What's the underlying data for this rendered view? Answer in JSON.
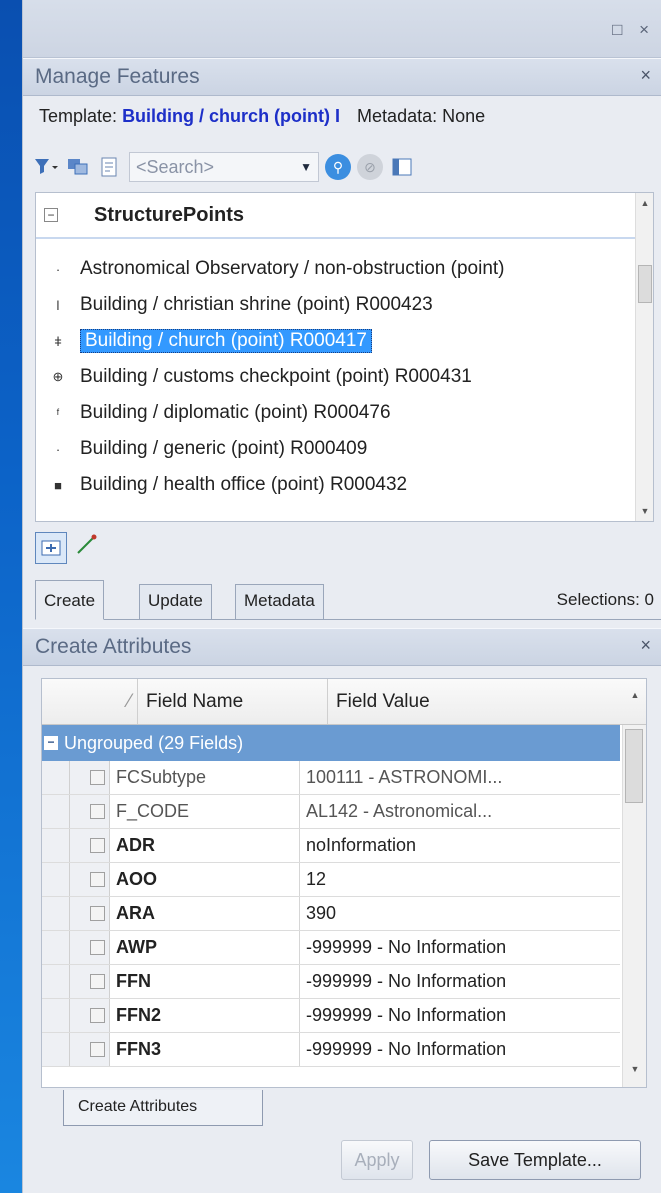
{
  "window": {
    "controls": "□ ×"
  },
  "manage_features": {
    "title": "Manage Features",
    "close": "×",
    "template_label": "Template:",
    "template_name": "Building / church (point) I",
    "metadata_label": "Metadata:",
    "metadata_value": "None",
    "search_placeholder": "<Search>",
    "layer_name": "StructurePoints",
    "items": [
      {
        "symbol": "·",
        "label": "Astronomical Observatory / non-obstruction (point)"
      },
      {
        "symbol": "ǀ",
        "label": "Building / christian shrine (point) R000423"
      },
      {
        "symbol": "ǂ",
        "label": "Building / church (point) R000417"
      },
      {
        "symbol": "⊕",
        "label": "Building / customs checkpoint (point) R000431"
      },
      {
        "symbol": "ᶠ",
        "label": "Building / diplomatic (point) R000476"
      },
      {
        "symbol": "·",
        "label": "Building / generic (point) R000409"
      },
      {
        "symbol": "■",
        "label": "Building / health office (point) R000432"
      }
    ],
    "selected_index": 2
  },
  "tabs": {
    "create": "Create",
    "update": "Update",
    "metadata": "Metadata"
  },
  "selections_text": "Selections: 0",
  "create_attributes": {
    "title": "Create Attributes",
    "close": "×",
    "col_field_name": "Field Name",
    "col_field_value": "Field Value",
    "group_label": "Ungrouped (29 Fields)",
    "rows": [
      {
        "name": "FCSubtype",
        "value": "100111 - ASTRONOMI...",
        "style": "dim"
      },
      {
        "name": "F_CODE",
        "value": "AL142 - Astronomical...",
        "style": "dim"
      },
      {
        "name": "ADR",
        "value": "noInformation",
        "style": "bold"
      },
      {
        "name": "AOO",
        "value": "12",
        "style": "bold"
      },
      {
        "name": "ARA",
        "value": "390",
        "style": "bold"
      },
      {
        "name": "AWP",
        "value": "-999999 - No Information",
        "style": "bold"
      },
      {
        "name": "FFN",
        "value": "-999999 - No Information",
        "style": "bold"
      },
      {
        "name": "FFN2",
        "value": "-999999 - No Information",
        "style": "bold"
      },
      {
        "name": "FFN3",
        "value": "-999999 - No Information",
        "style": "bold"
      }
    ],
    "bottom_tab": "Create Attributes",
    "apply_button": "Apply",
    "save_template_button": "Save Template..."
  }
}
